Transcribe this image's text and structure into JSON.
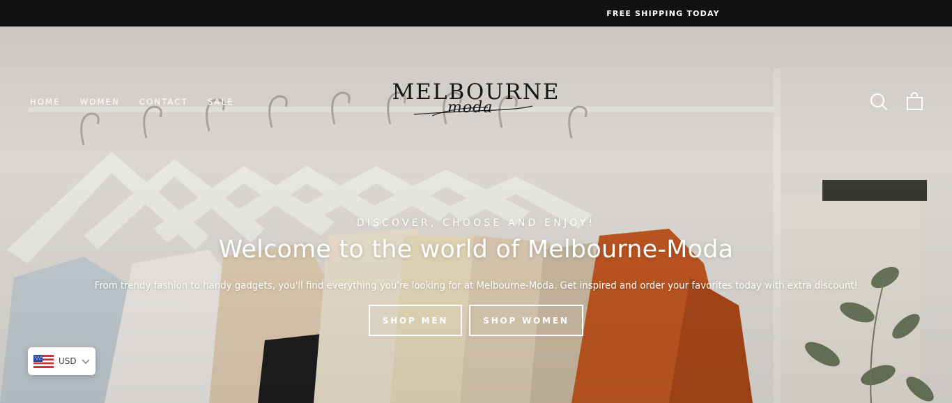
{
  "announcement": {
    "text": "FREE SHIPPING TODAY"
  },
  "nav": {
    "items": [
      {
        "label": "HOME"
      },
      {
        "label": "WOMEN"
      },
      {
        "label": "CONTACT"
      },
      {
        "label": "SALE"
      }
    ]
  },
  "brand": {
    "name": "MELBOURNE",
    "script": "moda"
  },
  "header_icons": {
    "search": "search-icon",
    "cart": "cart-icon"
  },
  "hero": {
    "subtitle": "DISCOVER, CHOOSE AND ENJOY!",
    "headline": "Welcome to the world of Melbourne-Moda",
    "text": "From trendy fashion to handy gadgets, you'll find everything you're looking for at Melbourne-Moda. Get inspired and order your favorites today with extra discount!",
    "buttons": [
      {
        "label": "SHOP MEN"
      },
      {
        "label": "SHOP WOMEN"
      }
    ]
  },
  "currency": {
    "code": "USD",
    "flag": "us-flag-icon",
    "chevron": "chevron-down-icon"
  }
}
